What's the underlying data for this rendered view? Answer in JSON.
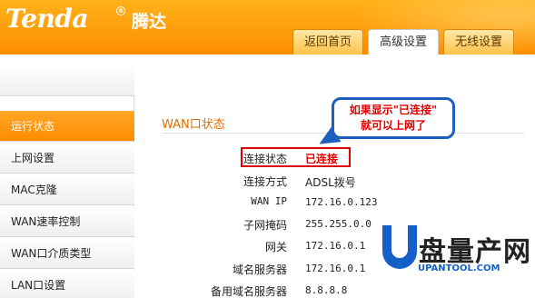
{
  "brand": {
    "logo": "Tenda",
    "name_cn": "腾达"
  },
  "tabs": [
    {
      "label": "返回首页"
    },
    {
      "label": "高级设置"
    },
    {
      "label": "无线设置"
    }
  ],
  "sidebar": {
    "items": [
      {
        "label": "运行状态"
      },
      {
        "label": "上网设置"
      },
      {
        "label": "MAC克隆"
      },
      {
        "label": "WAN速率控制"
      },
      {
        "label": "WAN口介质类型"
      },
      {
        "label": "LAN口设置"
      }
    ]
  },
  "wan_status": {
    "title": "WAN口状态",
    "rows": [
      {
        "label": "连接状态",
        "value": "已连接"
      },
      {
        "label": "连接方式",
        "value": "ADSL拨号"
      },
      {
        "label": "WAN IP",
        "value": "172.16.0.123"
      },
      {
        "label": "子网掩码",
        "value": "255.255.0.0"
      },
      {
        "label": "网关",
        "value": "172.16.0.1"
      },
      {
        "label": "域名服务器",
        "value": "172.16.0.1"
      },
      {
        "label": "备用域名服务器",
        "value": "8.8.8.8"
      }
    ]
  },
  "callout": {
    "line1": "如果显示\"已连接\"",
    "line2": "就可以上网了"
  },
  "watermark": {
    "text": "盘量产网",
    "url": "UPANTOOL.COM"
  },
  "colors": {
    "accent": "#ff8c00",
    "highlight": "#e00000",
    "callout_border": "#1c5fbf"
  }
}
